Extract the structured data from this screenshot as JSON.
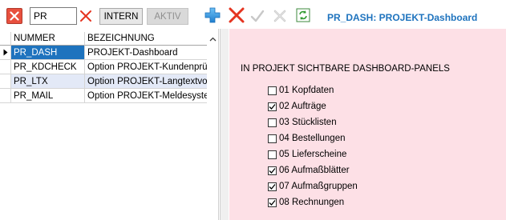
{
  "toolbar": {
    "filter_value": "PR",
    "intern_label": "INTERN",
    "aktiv_label": "AKTIV",
    "title": "PR_DASH: PROJEKT-Dashboard",
    "icons": {
      "close": "close-x-icon",
      "clear": "red-x-icon",
      "add": "blue-plus-icon",
      "delete": "red-x-icon",
      "ok": "check-icon",
      "cancel": "cancel-x-icon",
      "refresh": "refresh-icon"
    },
    "colors": {
      "title": "#1e73be",
      "close_bg": "#e8503e",
      "add": "#2d8fd6",
      "delete": "#e53420"
    }
  },
  "grid": {
    "columns": [
      "NUMMER",
      "BEZEICHNUNG"
    ],
    "rows": [
      {
        "nummer": "PR_DASH",
        "bezeichnung": "PROJEKT-Dashboard",
        "current": true
      },
      {
        "nummer": "PR_KDCHECK",
        "bezeichnung": "Option PROJEKT-Kundenprü"
      },
      {
        "nummer": "PR_LTX",
        "bezeichnung": "Option PROJEKT-Langtextvo"
      },
      {
        "nummer": "PR_MAIL",
        "bezeichnung": "Option PROJEKT-Meldesyste"
      }
    ],
    "selection_color": "#1e73be",
    "alt_row_color": "#e3e9f7"
  },
  "panel": {
    "title": "IN PROJEKT SICHTBARE DASHBOARD-PANELS",
    "background": "#fde0e6",
    "items": [
      {
        "label": "01 Kopfdaten",
        "checked": false
      },
      {
        "label": "02 Aufträge",
        "checked": true
      },
      {
        "label": "03 Stücklisten",
        "checked": false
      },
      {
        "label": "04 Bestellungen",
        "checked": false
      },
      {
        "label": "05 Lieferscheine",
        "checked": false
      },
      {
        "label": "06 Aufmaßblätter",
        "checked": true
      },
      {
        "label": "07 Aufmaßgruppen",
        "checked": true
      },
      {
        "label": "08 Rechnungen",
        "checked": true
      }
    ]
  }
}
